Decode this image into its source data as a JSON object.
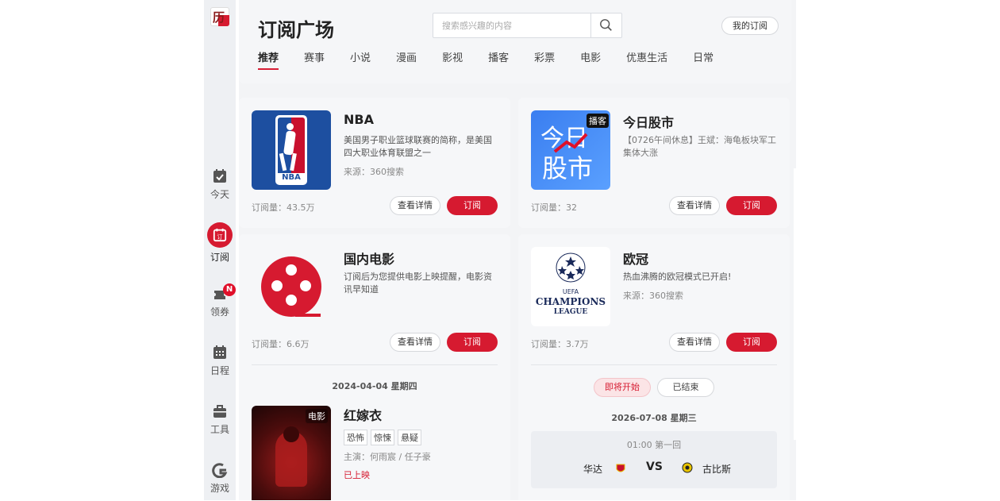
{
  "sidebar": {
    "logo_text": "历",
    "items": [
      {
        "label": "今天",
        "icon": "calendar-check-icon"
      },
      {
        "label": "订阅",
        "icon": "subscribe-calendar-icon",
        "active": true
      },
      {
        "label": "领券",
        "icon": "coupon-icon",
        "badge": "N"
      },
      {
        "label": "日程",
        "icon": "schedule-grid-icon"
      },
      {
        "label": "工具",
        "icon": "toolbox-icon"
      },
      {
        "label": "游戏",
        "icon": "game-icon"
      }
    ]
  },
  "header": {
    "title": "订阅广场",
    "search_placeholder": "搜索感兴趣的内容",
    "my_subscriptions": "我的订阅",
    "tabs": [
      "推荐",
      "赛事",
      "小说",
      "漫画",
      "影视",
      "播客",
      "彩票",
      "电影",
      "优惠生活",
      "日常"
    ]
  },
  "cards": {
    "nba": {
      "title": "NBA",
      "desc": "美国男子职业篮球联赛的简称，是美国四大职业体育联盟之一",
      "source": "来源：360搜索",
      "count": "订阅量：43.5万",
      "logo_text": "NBA"
    },
    "stock": {
      "title": "今日股市",
      "desc": "【0726午间休息】王斌：海龟板块军工集体大涨",
      "count": "订阅量：32",
      "badge": "播客",
      "cover_text1": "今日",
      "cover_text2": "股市"
    },
    "movie": {
      "title": "国内电影",
      "desc": "订阅后为您提供电影上映提醒，电影资讯早知道",
      "count": "订阅量：6.6万"
    },
    "ucl": {
      "title": "欧冠",
      "desc": "热血沸腾的欧冠模式已开启!",
      "source": "来源：360搜索",
      "count": "订阅量：3.7万",
      "logo_line1": "UEFA",
      "logo_line2": "CHAMPIONS",
      "logo_line3": "LEAGUE"
    }
  },
  "buttons": {
    "detail": "查看详情",
    "subscribe": "订阅"
  },
  "movie_list": {
    "date": "2024-04-04 星期四",
    "item": {
      "title": "红嫁衣",
      "tags": [
        "恐怖",
        "惊悚",
        "悬疑"
      ],
      "cast": "主演：何雨宸 / 任子豪",
      "status": "已上映",
      "badge": "电影"
    }
  },
  "ucl_schedule": {
    "filters": [
      "即将开始",
      "已结束"
    ],
    "date": "2026-07-08 星期三",
    "match": {
      "time_round": "01:00 第一回",
      "home": "华达",
      "away": "古比斯",
      "vs": "VS"
    }
  },
  "colors": {
    "accent": "#d61a30",
    "nba_blue": "#1d4fa0",
    "stock_blue": "#3a7ef0"
  }
}
